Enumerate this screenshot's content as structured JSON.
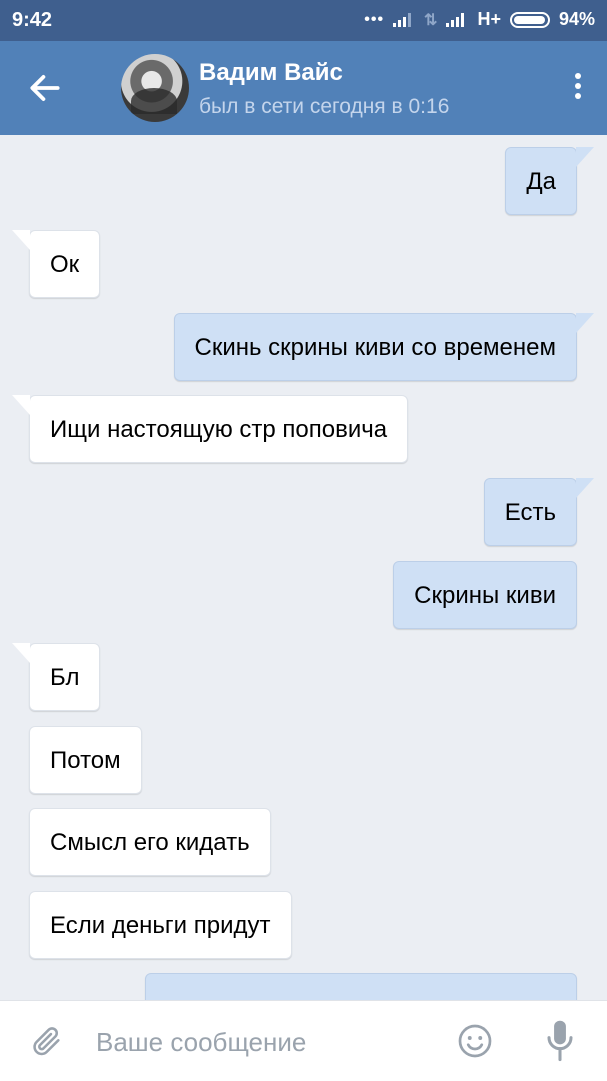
{
  "status_bar": {
    "time": "9:42",
    "network": "H+",
    "battery": "94%"
  },
  "header": {
    "name": "Вадим Вайс",
    "status": "был в сети сегодня в 0:16"
  },
  "messages": [
    {
      "direction": "out",
      "text": "Да"
    },
    {
      "direction": "in",
      "text": "Ок"
    },
    {
      "direction": "out",
      "text": "Скинь скрины киви со временем"
    },
    {
      "direction": "in",
      "text": "Ищи настоящую стр поповича"
    },
    {
      "direction": "out",
      "text": "Есть"
    },
    {
      "direction": "out",
      "text": "Скрины киви"
    },
    {
      "direction": "in",
      "text": "Бл"
    },
    {
      "direction": "in",
      "text": "Потом"
    },
    {
      "direction": "in",
      "text": "Смысл его кидать"
    },
    {
      "direction": "in",
      "text": "Если деньги придут"
    },
    {
      "direction": "out",
      "text": ""
    }
  ],
  "composer": {
    "placeholder": "Ваше сообщение"
  },
  "icons": {
    "back": "arrow-left-icon",
    "menu": "more-vertical-icon",
    "attach": "paperclip-icon",
    "emoji": "smile-icon",
    "voice": "microphone-icon"
  },
  "colors": {
    "status_bar": "#3f5f8e",
    "header": "#5181b8",
    "chat_background": "#ebeef3",
    "outgoing_bubble": "#cfe0f5",
    "incoming_bubble": "#ffffff"
  }
}
